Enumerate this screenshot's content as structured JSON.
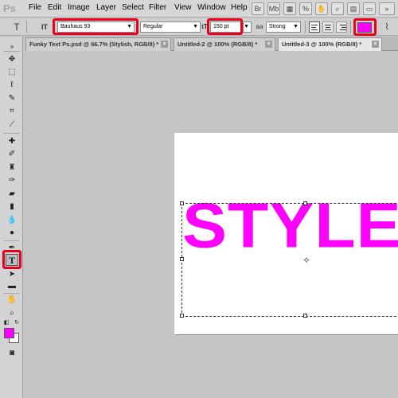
{
  "app": {
    "logo": "Ps"
  },
  "menu": [
    "File",
    "Edit",
    "Image",
    "Layer",
    "Select",
    "Filter",
    "View",
    "Window",
    "Help"
  ],
  "options_bar": {
    "tool_icon": "T",
    "orientation_icon": "IT",
    "font_family": "Bauhaus 93",
    "font_style": "Regular",
    "size_icon": "tT",
    "font_size": "150 pt",
    "aa_icon": "aa",
    "anti_alias": "Strong",
    "text_color": "#ff00ff"
  },
  "tabs": [
    {
      "label": "Funky Text Ps.psd @ 66.7% (Stylish, RGB/8) *",
      "close": "×"
    },
    {
      "label": "Untitled-2 @ 100% (RGB/8) *",
      "close": "×"
    },
    {
      "label": "Untitled-3 @ 100% (RGB/8) *",
      "close": "×"
    }
  ],
  "canvas": {
    "text": "STYLE",
    "text_color": "#ff00ff",
    "crosshair": "✧"
  },
  "colors": {
    "highlight": "#e8001c",
    "foreground": "#ff00ff",
    "background": "#ffffff"
  }
}
